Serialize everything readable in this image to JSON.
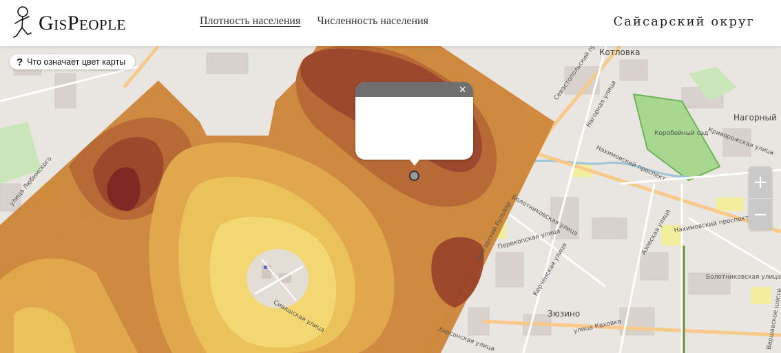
{
  "header": {
    "logo_text": "GisPeople",
    "nav": [
      {
        "label": "Плотность населения",
        "active": true
      },
      {
        "label": "Численность населения",
        "active": false
      }
    ],
    "region": "Сайсарский округ"
  },
  "map": {
    "help_label": "Что означает цвет карты",
    "help_icon": "?",
    "popup_close": "×",
    "zoom_in": "+",
    "zoom_out": "−",
    "place_labels": {
      "kotlovka": "Котловка",
      "nagorny": "Нагорный",
      "zyuzino": "Зюзино",
      "korobeyniy_sad": "Коробейный сад"
    },
    "street_labels": {
      "sevastopolsky": "Севастопольский проспект",
      "nakhimovsky": "Нахимовский проспект",
      "nakhimovsky2": "Нахимовский проспект",
      "bolotnikovskaya": "Болотниковская улица",
      "bolotnikovskaya2": "Болотниковская улица",
      "perekopskaya": "Перекопская улица",
      "kerchenskaya": "Керченская улица",
      "azovskaya": "Азовская улица",
      "khersonskaya": "Херсонская улица",
      "kakhovka": "улица Каховка",
      "nagornaya": "Нагорная улица",
      "krivorozhskaya": "Криворожская улица",
      "lyubimskogo": "улица Любимского",
      "chongarsky": "Чонгарский бульвар",
      "varshavskoye": "Варшавское шоссе",
      "sivashskaya": "Сивашская улица"
    },
    "colors": {
      "density_1": "#f4d66a",
      "density_2": "#ecbf4f",
      "density_3": "#e0a341",
      "density_4": "#cd8435",
      "density_5": "#b5612a",
      "density_6": "#963d1f",
      "density_7": "#771a16"
    }
  }
}
